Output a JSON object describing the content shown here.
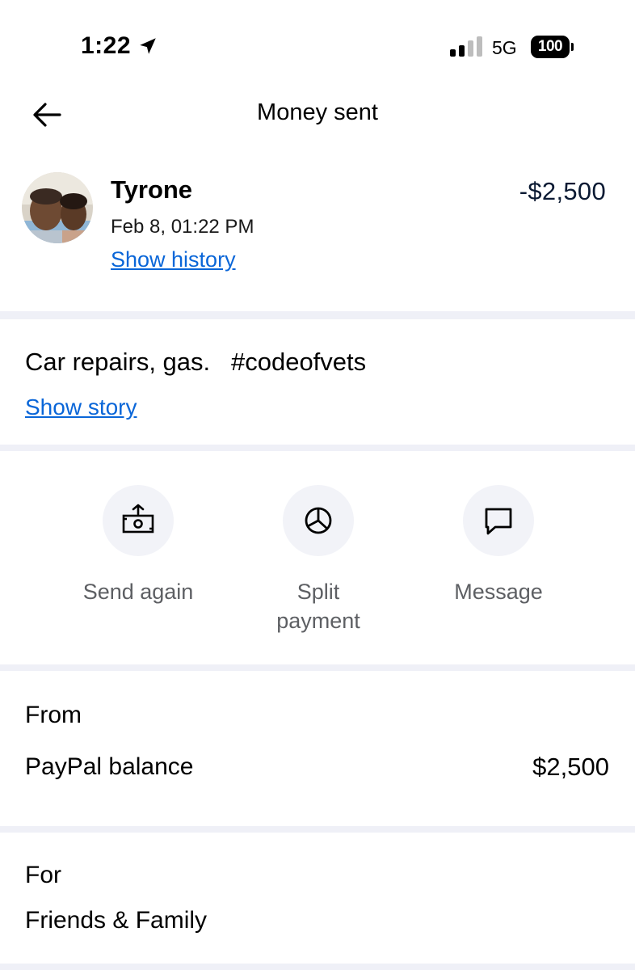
{
  "status_bar": {
    "time": "1:22",
    "network": "5G",
    "battery": "100",
    "icons": [
      "location-arrow-icon",
      "signal-icon",
      "battery-icon"
    ]
  },
  "header": {
    "title": "Money sent",
    "back_icon": "arrow-left-icon"
  },
  "recipient": {
    "name": "Tyrone",
    "date": "Feb 8, 01:22 PM",
    "history_link": "Show history",
    "amount": "-$2,500"
  },
  "note": {
    "text": "Car repairs, gas.   #codeofvets",
    "story_link": "Show story"
  },
  "actions": [
    {
      "label": "Send again",
      "icon": "send-money-icon"
    },
    {
      "label": "Split\npayment",
      "icon": "pie-chart-icon"
    },
    {
      "label": "Message",
      "icon": "message-bubble-icon"
    }
  ],
  "from": {
    "label": "From",
    "source": "PayPal balance",
    "amount": "$2,500"
  },
  "for": {
    "label": "For",
    "value": "Friends & Family"
  },
  "colors": {
    "link": "#0a66d8",
    "divider": "#eff0f7",
    "action_circle": "#f2f3f8",
    "amount_text": "#0b1a33",
    "muted_text": "#5d5f63"
  }
}
